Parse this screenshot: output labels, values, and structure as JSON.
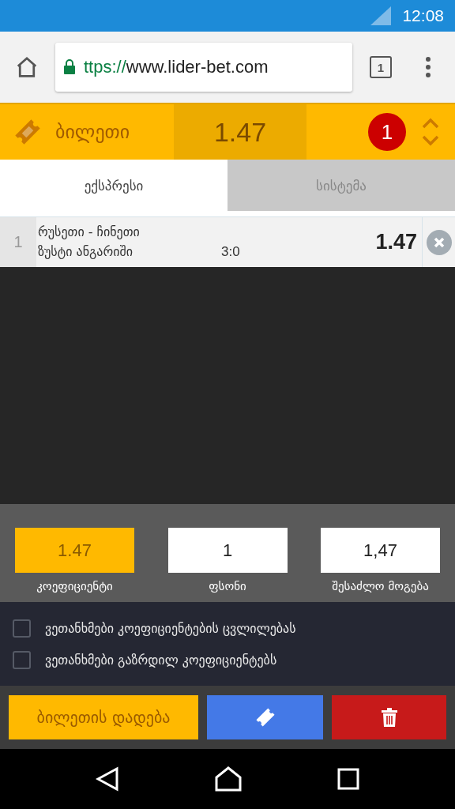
{
  "status_bar": {
    "time": "12:08"
  },
  "browser": {
    "url_scheme": "ttps://",
    "url_host": "www.lider-bet.com",
    "tab_count": "1"
  },
  "ticket_header": {
    "title": "ბილეთი",
    "total_odds": "1.47",
    "count": "1"
  },
  "tabs": [
    {
      "label": "ექსპრესი",
      "selected": true
    },
    {
      "label": "სისტემა",
      "selected": false
    }
  ],
  "bets": [
    {
      "number": "1",
      "match": "რუსეთი - ჩინეთი",
      "market": "ზუსტი ანგარიში",
      "pick": "3:0",
      "odds": "1.47"
    }
  ],
  "summary": [
    {
      "kind": "highlight",
      "value": "1.47",
      "label": "კოეფიციენტი"
    },
    {
      "kind": "plain",
      "value": "1",
      "label": "ფსონი"
    },
    {
      "kind": "plain",
      "value": "1,47",
      "label": "შესაძლო მოგება"
    }
  ],
  "options": [
    {
      "label": "ვეთანხმები კოეფიციენტების ცვლილებას",
      "checked": false
    },
    {
      "label": "ვეთანხმები გაზრდილ კოეფიციენტებს",
      "checked": false
    }
  ],
  "actions": {
    "place_bet": "ბილეთის დადება"
  }
}
